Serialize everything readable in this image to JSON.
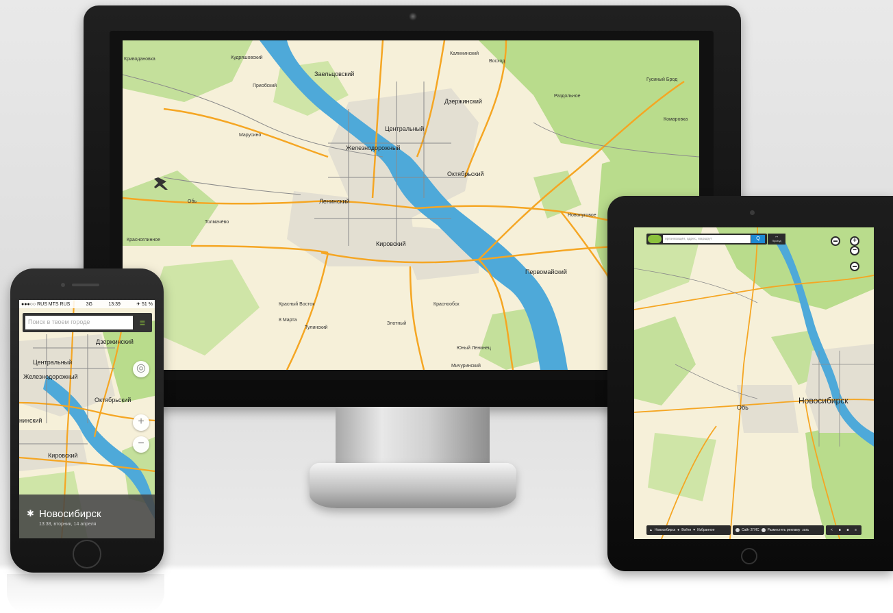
{
  "desktop": {
    "places": {
      "krivodanovka": "Криводановка",
      "kudryashovsky": "Кудряшовский",
      "kalininsky": "Калининский",
      "voskhod": "Восход",
      "priobsky": "Приобский",
      "zaeltsovsky": "Заельцовский",
      "gusiny_brod": "Гусиный Брод",
      "dzerzhinsky": "Дзержинский",
      "razdolnoe": "Раздольное",
      "tsentralny": "Центральный",
      "komarovka": "Комаровка",
      "marusino": "Марусино",
      "zheleznodorozhny": "Железнодорожный",
      "oktyabrsky": "Октябрьский",
      "ob": "Обь",
      "leninsky": "Ленинский",
      "novolugovoe": "Новолуговое",
      "tolmachevo": "Толмачёво",
      "krasnoglinnoe": "Красноглинное",
      "kirovsky": "Кировский",
      "pervomaysky": "Первомайский",
      "krasny_vostok": "Красный Восток",
      "krasnoobsk": "Краснообск",
      "8marta": "8 Марта",
      "zolotoy": "Злотный",
      "tulinsky": "Тулинский",
      "yuny_leninets": "Юный Ленинец",
      "mochishche": "Мичуринский"
    }
  },
  "tablet": {
    "search_placeholder": "организация, адрес, маршрут",
    "search_button": "Q",
    "route_label": "Проезд",
    "zoom_in": "+",
    "zoom_out": "−",
    "city_label": "Новосибирск",
    "ob_label": "Обь",
    "bottom": {
      "city": "Новосибирск",
      "login": "Войти",
      "favorites": "Избранное",
      "site": "Сайт 2ГИС",
      "ads": "Разместить рекламу",
      "ads_suffix": "зать"
    }
  },
  "phone": {
    "status": {
      "left": "●●●○○ RUS MTS RUS",
      "network": "3G",
      "time": "13:39",
      "right": "✈ 51 %"
    },
    "search_placeholder": "Поиск в твоем городе",
    "menu_icon": "≡",
    "locate": "◎",
    "zoom_in": "+",
    "zoom_out": "−",
    "map_labels": {
      "dzerzhinsky": "Дзержинский",
      "tsentralny": "Центральный",
      "zheleznodorozhny": "Железнодорожный",
      "oktyabrsky": "Октябрьский",
      "leninsky": "нинский",
      "kirovsky": "Кировский"
    },
    "info": {
      "city": "Новосибирск",
      "date": "13:38, вторник, 14 апреля"
    }
  }
}
